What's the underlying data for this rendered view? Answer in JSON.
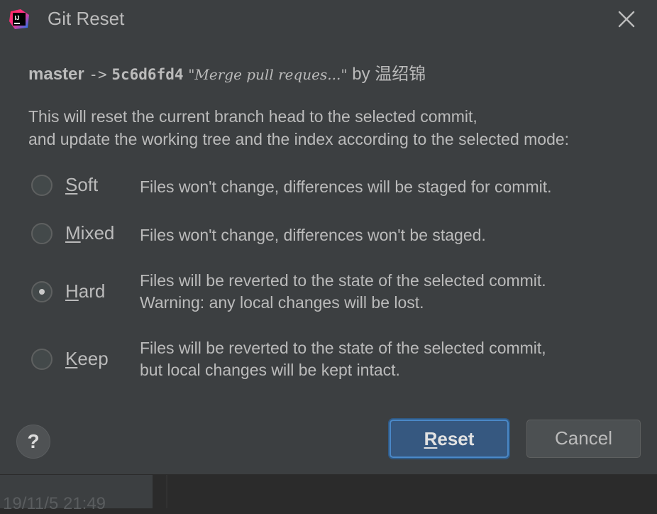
{
  "dialog": {
    "title": "Git Reset",
    "app_icon_text": "IJ"
  },
  "commit": {
    "branch": "master",
    "arrow": "->",
    "hash": "5c6d6fd4",
    "message": "\"Merge pull reques...\"",
    "by": "by",
    "author": "温绍锦"
  },
  "description": {
    "line1": "This will reset the current branch head to the selected commit,",
    "line2": "and update the working tree and the index according to the selected mode:"
  },
  "modes": [
    {
      "mnemonic": "S",
      "rest": "oft",
      "desc1": "Files won't change, differences will be staged for commit.",
      "desc2": "",
      "checked": false
    },
    {
      "mnemonic": "M",
      "rest": "ixed",
      "desc1": "Files won't change, differences won't be staged.",
      "desc2": "",
      "checked": false
    },
    {
      "mnemonic": "H",
      "rest": "ard",
      "desc1": "Files will be reverted to the state of the selected commit.",
      "desc2": "Warning: any local changes will be lost.",
      "checked": true
    },
    {
      "mnemonic": "K",
      "rest": "eep",
      "desc1": "Files will be reverted to the state of the selected commit,",
      "desc2": "but local changes will be kept intact.",
      "checked": false
    }
  ],
  "buttons": {
    "help": "?",
    "reset_mnemonic": "R",
    "reset_rest": "eset",
    "cancel": "Cancel"
  },
  "background": {
    "date_text": "19/11/5 21:49"
  },
  "colors": {
    "dialog_bg": "#3c3f41",
    "text": "#bbbbbb",
    "primary_button": "#365880",
    "primary_border": "#4a88c7"
  }
}
